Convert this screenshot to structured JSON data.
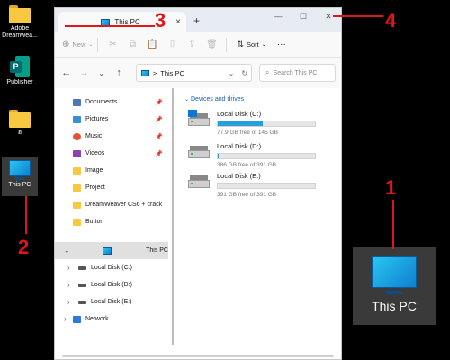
{
  "desktop": {
    "icons": [
      {
        "label": "Adobe\nDreamwea...",
        "type": "folder"
      },
      {
        "label": "Publisher",
        "type": "publisher"
      },
      {
        "label": "ฮ",
        "type": "folder"
      },
      {
        "label": "This PC",
        "type": "pc"
      }
    ],
    "preview_tile_label": "This PC"
  },
  "annotations": [
    "1",
    "2",
    "3",
    "4"
  ],
  "explorer": {
    "tab_title": "This PC",
    "tab_close": "×",
    "new_tab": "+",
    "window_buttons": {
      "minimize": "—",
      "maximize": "☐",
      "close": "✕"
    },
    "command_bar": {
      "new_label": "New",
      "sort_label": "Sort",
      "more_label": "···"
    },
    "address": {
      "path": "This PC",
      "chevron": ">"
    },
    "search_placeholder": "Search This PC",
    "nav_pane": {
      "quick_access": [
        {
          "label": "Documents",
          "icon": "documents-icon",
          "pinned": true
        },
        {
          "label": "Pictures",
          "icon": "pictures-icon",
          "pinned": true
        },
        {
          "label": "Music",
          "icon": "music-icon",
          "pinned": true
        },
        {
          "label": "Videos",
          "icon": "videos-icon",
          "pinned": true
        },
        {
          "label": "Image",
          "icon": "folder-icon",
          "pinned": false
        },
        {
          "label": "Project",
          "icon": "folder-icon",
          "pinned": false
        },
        {
          "label": "DreamWeaver CS6 + crack",
          "icon": "folder-icon",
          "pinned": false
        },
        {
          "label": "Button",
          "icon": "folder-icon",
          "pinned": false
        }
      ],
      "this_pc": "This PC",
      "drives": [
        "Local Disk (C:)",
        "Local Disk (D:)",
        "Local Disk (E:)"
      ],
      "network": "Network"
    },
    "content": {
      "section_header": "Devices and drives",
      "drives": [
        {
          "name": "Local Disk (C:)",
          "free_text": "77.9 GB free of 145 GB",
          "used_fraction": 0.46
        },
        {
          "name": "Local Disk (D:)",
          "free_text": "386 GB free of 391 GB",
          "used_fraction": 0.013
        },
        {
          "name": "Local Disk (E:)",
          "free_text": "391 GB free of 391 GB",
          "used_fraction": 0.0
        }
      ]
    }
  },
  "colors": {
    "annotation": "#e0161b",
    "drive_bar_fill": "#26a0da",
    "section_header": "#1a5fb4"
  }
}
